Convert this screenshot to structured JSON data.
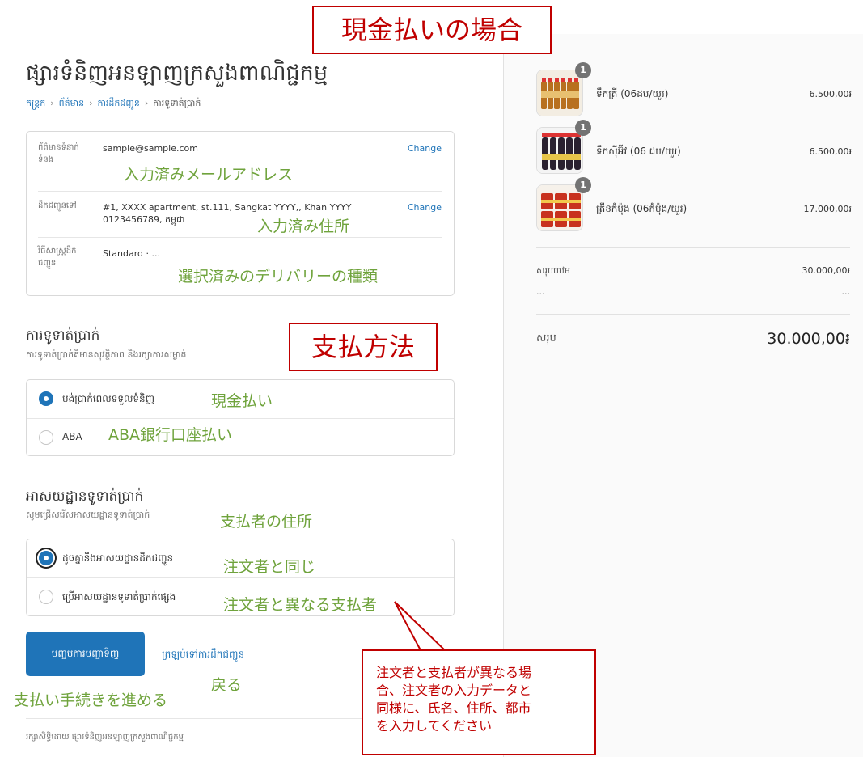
{
  "store_name": "ផ្សារទំនិញអនឡាញក្រសួងពាណិជ្ជកម្ម",
  "breadcrumb": {
    "cart": "កន្ត្រក",
    "info": "ព័ត៌មាន",
    "shipping": "ការដឹកជញ្ជូន",
    "payment": "ការទូទាត់ប្រាក់"
  },
  "review": {
    "contact_label": "ព័ត៌មានទំនាក់ទំនង",
    "contact_value": "sample@sample.com",
    "ship_to_label": "ដឹកជញ្ជូនទៅ",
    "ship_to_line1": "#1, XXXX apartment, st.111, Sangkat YYYY,, Khan YYYY",
    "ship_to_line2": "0123456789, កម្ពុជា",
    "method_label": "វិធីសាស្ត្រដឹកជញ្ជូន",
    "method_value": "Standard · ...",
    "change": "Change"
  },
  "payment": {
    "title": "ការទូទាត់ប្រាក់",
    "subtitle": "ការទូទាត់ប្រាក់គឺមានសុវត្ថិភាព និងរក្សាការសម្ងាត់",
    "options": [
      "បង់ប្រាក់ពេលទទួលទំនិញ",
      "ABA"
    ]
  },
  "billing": {
    "title": "អាសយដ្ឋានទូទាត់ប្រាក់",
    "subtitle": "សូមជ្រើសរើសអាសយដ្ឋានទូទាត់ប្រាក់",
    "options": [
      "ដូចគ្នានឹងអាសយដ្ឋានដឹកជញ្ជូន",
      "ប្រើអាសយដ្ឋានទូទាត់ប្រាក់ផ្សេង"
    ]
  },
  "actions": {
    "complete": "បញ្ចប់ការបញ្ជាទិញ",
    "back": "ត្រឡប់ទៅការដឹកជញ្ជូន"
  },
  "footer": "រក្សាសិទ្ធិដោយ ផ្សារទំនិញអនឡាញក្រសួងពាណិជ្ជកម្ម",
  "order": {
    "items": [
      {
        "name": "ទឹកត្រី (06ដប/យួរ)",
        "price": "6.500,00៛",
        "qty": "1"
      },
      {
        "name": "ទឹកស៊ីអ៊ីវ (06 ដប/យួរ)",
        "price": "6.500,00៛",
        "qty": "1"
      },
      {
        "name": "ត្រីខកំប៉ុង (06កំប៉ុង/យួរ)",
        "price": "17.000,00៛",
        "qty": "1"
      }
    ],
    "subtotal_label": "សរុបបឋម",
    "subtotal": "30.000,00៛",
    "ellipsis": "...",
    "total_label": "សរុប",
    "total": "30.000,00៛"
  },
  "annotations": {
    "header": "現金払いの場合",
    "payment_method": "支払方法",
    "email": "入力済みメールアドレス",
    "address": "入力済み住所",
    "delivery": "選択済みのデリバリーの種類",
    "cash": "現金払い",
    "aba": "ABA銀行口座払い",
    "payer_address": "支払者の住所",
    "same": "注文者と同じ",
    "different": "注文者と異なる支払者",
    "proceed": "支払い手続きを進める",
    "back": "戻る",
    "callout_lines": [
      "注文者と支払者が異なる場",
      "合、注文者の入力データと",
      "同様に、氏名、住所、都市",
      "を入力してください"
    ]
  },
  "colors": {
    "accent": "#1f74b8",
    "annotation_green": "#6fa33c",
    "annotation_red": "#c00000"
  }
}
